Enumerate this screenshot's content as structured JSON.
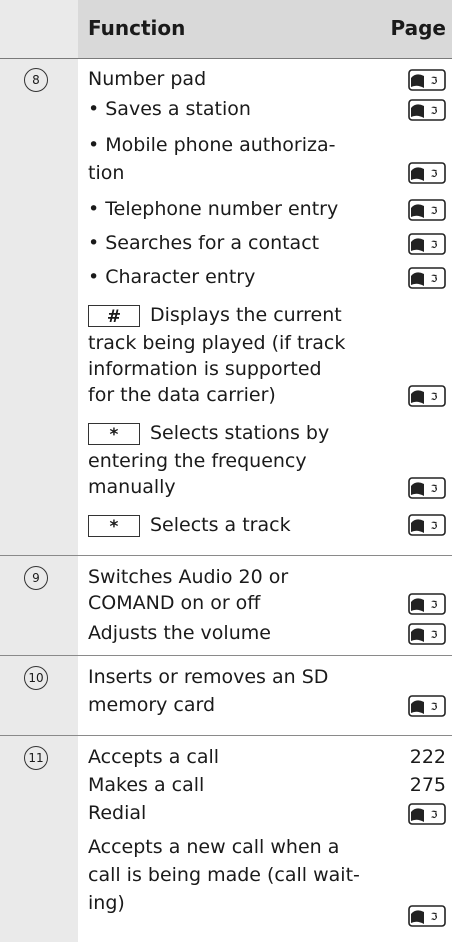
{
  "header": {
    "function_label": "Function",
    "page_label": "Page"
  },
  "sections": [
    {
      "number": "8",
      "lines": [
        "Number pad",
        "• Saves a station",
        "• Mobile phone authoriza-",
        "tion",
        "• Telephone number entry",
        "• Searches for a contact",
        "• Character entry",
        "Displays the current",
        "track being played (if track",
        "information is supported",
        "for the data carrier)",
        "Selects stations by",
        "entering the frequency",
        "manually",
        "Selects a track"
      ],
      "keys": [
        "#",
        "*",
        "*"
      ]
    },
    {
      "number": "9",
      "lines": [
        "Switches Audio 20 or",
        "COMAND on or off",
        "Adjusts the volume"
      ]
    },
    {
      "number": "10",
      "lines": [
        "Inserts or removes an SD",
        "memory card"
      ]
    },
    {
      "number": "11",
      "lines": [
        "Accepts a call",
        "Makes a call",
        "Redial",
        "Accepts a new call when a",
        "call is being made (call wait-",
        "ing)"
      ],
      "pages": [
        "222",
        "275"
      ]
    }
  ],
  "page_ref_icon": "page-reference-icon"
}
